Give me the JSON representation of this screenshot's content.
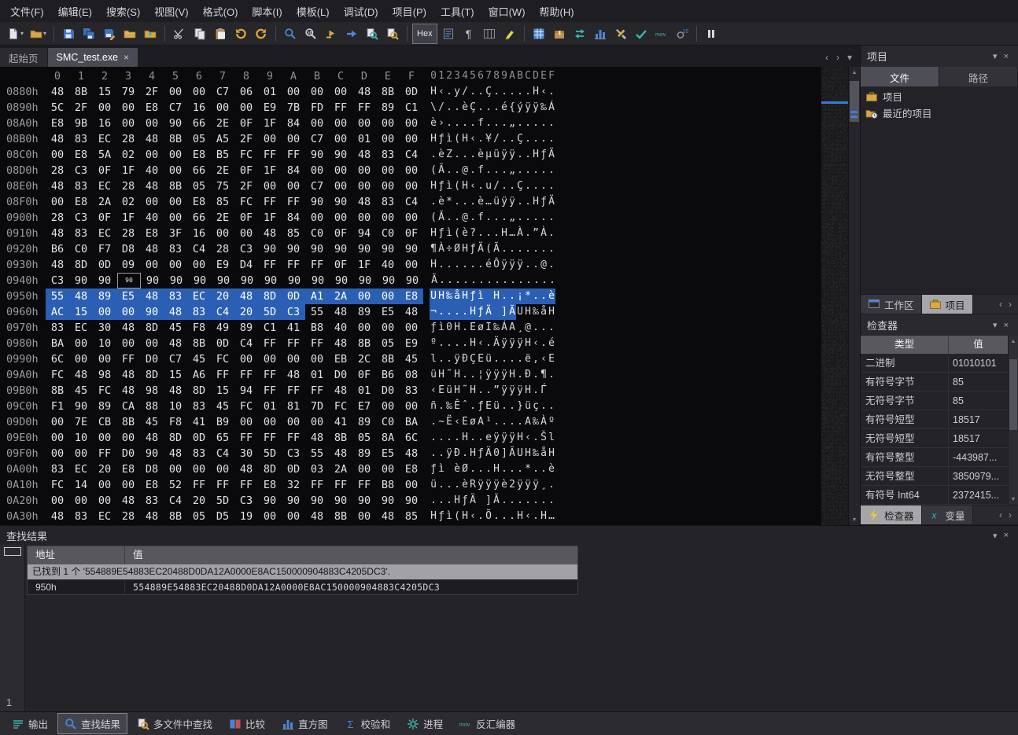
{
  "colors": {
    "selection_blue": "#2b5fb4",
    "accent_blue": "#4a86d8",
    "folder_yellow": "#d9a648",
    "teal": "#38b8ae",
    "hex_background": "#0a0a0d"
  },
  "menubar": {
    "items": [
      "文件(F)",
      "编辑(E)",
      "搜索(S)",
      "视图(V)",
      "格式(O)",
      "脚本(I)",
      "模板(L)",
      "调试(D)",
      "项目(P)",
      "工具(T)",
      "窗口(W)",
      "帮助(H)"
    ]
  },
  "toolbar": {
    "buttons": [
      {
        "name": "new-file-button",
        "icon": "page",
        "caret": true
      },
      {
        "name": "open-file-button",
        "icon": "folder",
        "caret": true
      },
      {
        "sep": true
      },
      {
        "name": "save-button",
        "icon": "floppy"
      },
      {
        "name": "save-all-button",
        "icon": "floppy-all"
      },
      {
        "name": "save-as-button",
        "icon": "floppy-pen"
      },
      {
        "name": "open-folder-button",
        "icon": "folder-open"
      },
      {
        "name": "import-hex-button",
        "icon": "folder-arrow"
      },
      {
        "sep": true
      },
      {
        "name": "cut-button",
        "icon": "scissors"
      },
      {
        "name": "copy-button",
        "icon": "copy"
      },
      {
        "name": "paste-button",
        "icon": "paste"
      },
      {
        "name": "undo-button",
        "icon": "undo"
      },
      {
        "name": "redo-button",
        "icon": "redo"
      },
      {
        "sep": true
      },
      {
        "name": "find-button",
        "icon": "magnifier"
      },
      {
        "name": "replace-button",
        "icon": "magnifier-ab"
      },
      {
        "name": "goto-button",
        "icon": "jump"
      },
      {
        "name": "goto-again-button",
        "icon": "arrow-right"
      },
      {
        "name": "find-in-files-button",
        "icon": "magnifier-files"
      },
      {
        "name": "replace-in-files-button",
        "icon": "magnifier-files-yellow"
      },
      {
        "sep": true
      },
      {
        "name": "hex-mode-toggle",
        "label": "Hex",
        "pressed": true
      },
      {
        "name": "edit-as-text-button",
        "icon": "doc-lines"
      },
      {
        "name": "show-whitespace-button",
        "glyph": "¶"
      },
      {
        "name": "column-mode-button",
        "icon": "columns"
      },
      {
        "name": "highlight-button",
        "icon": "marker"
      },
      {
        "sep": true
      },
      {
        "name": "calculator-button",
        "icon": "grid-blue"
      },
      {
        "name": "templates-button",
        "icon": "package"
      },
      {
        "name": "converter-button",
        "icon": "swap"
      },
      {
        "name": "histogram-button",
        "icon": "bars"
      },
      {
        "name": "script-tools-button",
        "icon": "tools"
      },
      {
        "name": "checksum-button",
        "icon": "check"
      },
      {
        "name": "disassembler-button",
        "icon": "mov-text"
      },
      {
        "name": "base-converter-button",
        "icon": "gear10"
      },
      {
        "sep": true
      },
      {
        "name": "pause-button",
        "icon": "pause"
      }
    ]
  },
  "tabbar": {
    "tabs": [
      {
        "name": "tab-start-page",
        "label": "起始页",
        "active": false,
        "close": false
      },
      {
        "name": "tab-smc-test-exe",
        "label": "SMC_test.exe",
        "active": true,
        "close": true
      }
    ],
    "nav_prev": "‹",
    "nav_next": "›",
    "nav_menu": "▾"
  },
  "hex_editor": {
    "column_header": [
      "0",
      "1",
      "2",
      "3",
      "4",
      "5",
      "6",
      "7",
      "8",
      "9",
      "A",
      "B",
      "C",
      "D",
      "E",
      "F"
    ],
    "ascii_header": "0123456789ABCDEF",
    "rows": [
      {
        "addr": "0880h",
        "bytes": "48 8B 15 79 2F 00 00 C7 06 01 00 00 00 48 8B 0D",
        "ascii": "H‹.y/..Ç.....H‹."
      },
      {
        "addr": "0890h",
        "bytes": "5C 2F 00 00 E8 C7 16 00 00 E9 7B FD FF FF 89 C1",
        "ascii": "\\/..èÇ...é{ýÿÿ‰Á"
      },
      {
        "addr": "08A0h",
        "bytes": "E8 9B 16 00 00 90 66 2E 0F 1F 84 00 00 00 00 00",
        "ascii": "è›....f...„....."
      },
      {
        "addr": "08B0h",
        "bytes": "48 83 EC 28 48 8B 05 A5 2F 00 00 C7 00 01 00 00",
        "ascii": "Hƒì(H‹.¥/..Ç...."
      },
      {
        "addr": "08C0h",
        "bytes": "00 E8 5A 02 00 00 E8 B5 FC FF FF 90 90 48 83 C4",
        "ascii": ".èZ...èµüÿÿ..HƒÄ"
      },
      {
        "addr": "08D0h",
        "bytes": "28 C3 0F 1F 40 00 66 2E 0F 1F 84 00 00 00 00 00",
        "ascii": "(Ã..@.f...„....."
      },
      {
        "addr": "08E0h",
        "bytes": "48 83 EC 28 48 8B 05 75 2F 00 00 C7 00 00 00 00",
        "ascii": "Hƒì(H‹.u/..Ç...."
      },
      {
        "addr": "08F0h",
        "bytes": "00 E8 2A 02 00 00 E8 85 FC FF FF 90 90 48 83 C4",
        "ascii": ".è*...è…üÿÿ..HƒÄ"
      },
      {
        "addr": "0900h",
        "bytes": "28 C3 0F 1F 40 00 66 2E 0F 1F 84 00 00 00 00 00",
        "ascii": "(Ã..@.f...„....."
      },
      {
        "addr": "0910h",
        "bytes": "48 83 EC 28 E8 3F 16 00 00 48 85 C0 0F 94 C0 0F",
        "ascii": "Hƒì(è?...H…À.”À."
      },
      {
        "addr": "0920h",
        "bytes": "B6 C0 F7 D8 48 83 C4 28 C3 90 90 90 90 90 90 90",
        "ascii": "¶À÷ØHƒÄ(Ã......."
      },
      {
        "addr": "0930h",
        "bytes": "48 8D 0D 09 00 00 00 E9 D4 FF FF FF 0F 1F 40 00",
        "ascii": "H......éÔÿÿÿ..@."
      },
      {
        "addr": "0940h",
        "bytes": "C3 90 90 90 90 90 90 90 90 90 90 90 90 90 90 90",
        "ascii": "Ã...............",
        "caret_col": 3
      },
      {
        "addr": "0950h",
        "bytes": "55 48 89 E5 48 83 EC 20 48 8D 0D A1 2A 00 00 E8",
        "ascii": "UH‰åHƒì H..¡*..è",
        "sel": [
          0,
          15
        ]
      },
      {
        "addr": "0960h",
        "bytes": "AC 15 00 00 90 48 83 C4 20 5D C3 55 48 89 E5 48",
        "ascii": "¬....HƒÄ ]ÃUH‰åH",
        "sel": [
          0,
          10
        ]
      },
      {
        "addr": "0970h",
        "bytes": "83 EC 30 48 8D 45 F8 49 89 C1 41 B8 40 00 00 00",
        "ascii": "ƒì0H.EøI‰ÁA¸@..."
      },
      {
        "addr": "0980h",
        "bytes": "BA 00 10 00 00 48 8B 0D C4 FF FF FF 48 8B 05 E9",
        "ascii": "º....H‹.ÄÿÿÿH‹.é"
      },
      {
        "addr": "0990h",
        "bytes": "6C 00 00 FF D0 C7 45 FC 00 00 00 00 EB 2C 8B 45",
        "ascii": "l..ÿÐÇEü....ë,‹E"
      },
      {
        "addr": "09A0h",
        "bytes": "FC 48 98 48 8D 15 A6 FF FF FF 48 01 D0 0F B6 08",
        "ascii": "üH˜H..¦ÿÿÿH.Ð.¶."
      },
      {
        "addr": "09B0h",
        "bytes": "8B 45 FC 48 98 48 8D 15 94 FF FF FF 48 01 D0 83",
        "ascii": "‹EüH˜H..”ÿÿÿH.Ѓ"
      },
      {
        "addr": "09C0h",
        "bytes": "F1 90 89 CA 88 10 83 45 FC 01 81 7D FC E7 00 00",
        "ascii": "ñ.‰Êˆ.ƒEü..}üç.."
      },
      {
        "addr": "09D0h",
        "bytes": "00 7E CB 8B 45 F8 41 B9 00 00 00 00 41 89 C0 BA",
        "ascii": ".~Ë‹EøA¹....A‰Àº"
      },
      {
        "addr": "09E0h",
        "bytes": "00 10 00 00 48 8D 0D 65 FF FF FF 48 8B 05 8A 6C",
        "ascii": "....H..eÿÿÿH‹.Šl"
      },
      {
        "addr": "09F0h",
        "bytes": "00 00 FF D0 90 48 83 C4 30 5D C3 55 48 89 E5 48",
        "ascii": "..ÿÐ.HƒÄ0]ÃUH‰åH"
      },
      {
        "addr": "0A00h",
        "bytes": "83 EC 20 E8 D8 00 00 00 48 8D 0D 03 2A 00 00 E8",
        "ascii": "ƒì èØ...H...*..è"
      },
      {
        "addr": "0A10h",
        "bytes": "FC 14 00 00 E8 52 FF FF FF E8 32 FF FF FF B8 00",
        "ascii": "ü...èRÿÿÿè2ÿÿÿ¸."
      },
      {
        "addr": "0A20h",
        "bytes": "00 00 00 48 83 C4 20 5D C3 90 90 90 90 90 90 90",
        "ascii": "...HƒÄ ]Ã......."
      },
      {
        "addr": "0A30h",
        "bytes": "48 83 EC 28 48 8B 05 D5 19 00 00 48 8B 00 48 85",
        "ascii": "Hƒì(H‹.Õ...H‹.H…"
      }
    ]
  },
  "project_panel": {
    "title": "项目",
    "collapse": "▾",
    "close": "×",
    "tabs": [
      {
        "name": "project-tab-files",
        "label": "文件",
        "active": true
      },
      {
        "name": "project-tab-paths",
        "label": "路径",
        "active": false
      }
    ],
    "items": [
      {
        "name": "tree-item-project",
        "label": "项目",
        "icon": "case-yellow"
      },
      {
        "name": "tree-item-recent-projects",
        "label": "最近的项目",
        "icon": "clock-folder"
      }
    ],
    "bottom_tabs": [
      {
        "name": "workspace-tab",
        "label": "工作区",
        "icon": "workspace",
        "active": false
      },
      {
        "name": "project-tab",
        "label": "项目",
        "icon": "case-yellow",
        "active": true
      }
    ],
    "nav_prev": "‹",
    "nav_next": "›"
  },
  "inspector": {
    "title": "检查器",
    "collapse": "▾",
    "close": "×",
    "columns": [
      "类型",
      "值"
    ],
    "rows": [
      [
        "二进制",
        "01010101"
      ],
      [
        "有符号字节",
        "85"
      ],
      [
        "无符号字节",
        "85"
      ],
      [
        "有符号短型",
        "18517"
      ],
      [
        "无符号短型",
        "18517"
      ],
      [
        "有符号整型",
        "-443987..."
      ],
      [
        "无符号整型",
        "3850979..."
      ],
      [
        "有符号 Int64",
        "2372415..."
      ]
    ],
    "bottom_tabs": [
      {
        "name": "inspector-tab",
        "label": "检查器",
        "icon": "lightning",
        "active": true
      },
      {
        "name": "variables-tab",
        "label": "变量",
        "icon": "variable",
        "active": false
      }
    ],
    "nav_prev": "‹",
    "nav_next": "›"
  },
  "find_results": {
    "title": "查找结果",
    "collapse": "▾",
    "close": "×",
    "columns": [
      "地址",
      "值"
    ],
    "summary": "已找到 1 个 '554889E54883EC20488D0DA12A0000E8AC150000904883C4205DC3'.",
    "rows": [
      {
        "address": "950h",
        "value": "554889E54883EC20488D0DA12A0000E8AC150000904883C4205DC3"
      }
    ],
    "gutter_label": "1"
  },
  "statusbar": {
    "items": [
      {
        "name": "output-panel-button",
        "label": "输出",
        "icon": "output-lines",
        "active": false
      },
      {
        "name": "find-results-panel-button",
        "label": "查找结果",
        "icon": "magnifier",
        "active": true
      },
      {
        "name": "find-in-files-panel-button",
        "label": "多文件中查找",
        "icon": "magnifier-files-yellow",
        "active": false
      },
      {
        "name": "compare-panel-button",
        "label": "比较",
        "icon": "compare",
        "active": false
      },
      {
        "name": "histogram-panel-button",
        "label": "直方图",
        "icon": "bars",
        "active": false
      },
      {
        "name": "checksum-panel-button",
        "label": "校验和",
        "icon": "sigma",
        "active": false
      },
      {
        "name": "processes-panel-button",
        "label": "进程",
        "icon": "gear-teal",
        "active": false
      },
      {
        "name": "disassembler-panel-button",
        "label": "反汇编器",
        "icon": "mov-text",
        "active": false
      }
    ]
  }
}
